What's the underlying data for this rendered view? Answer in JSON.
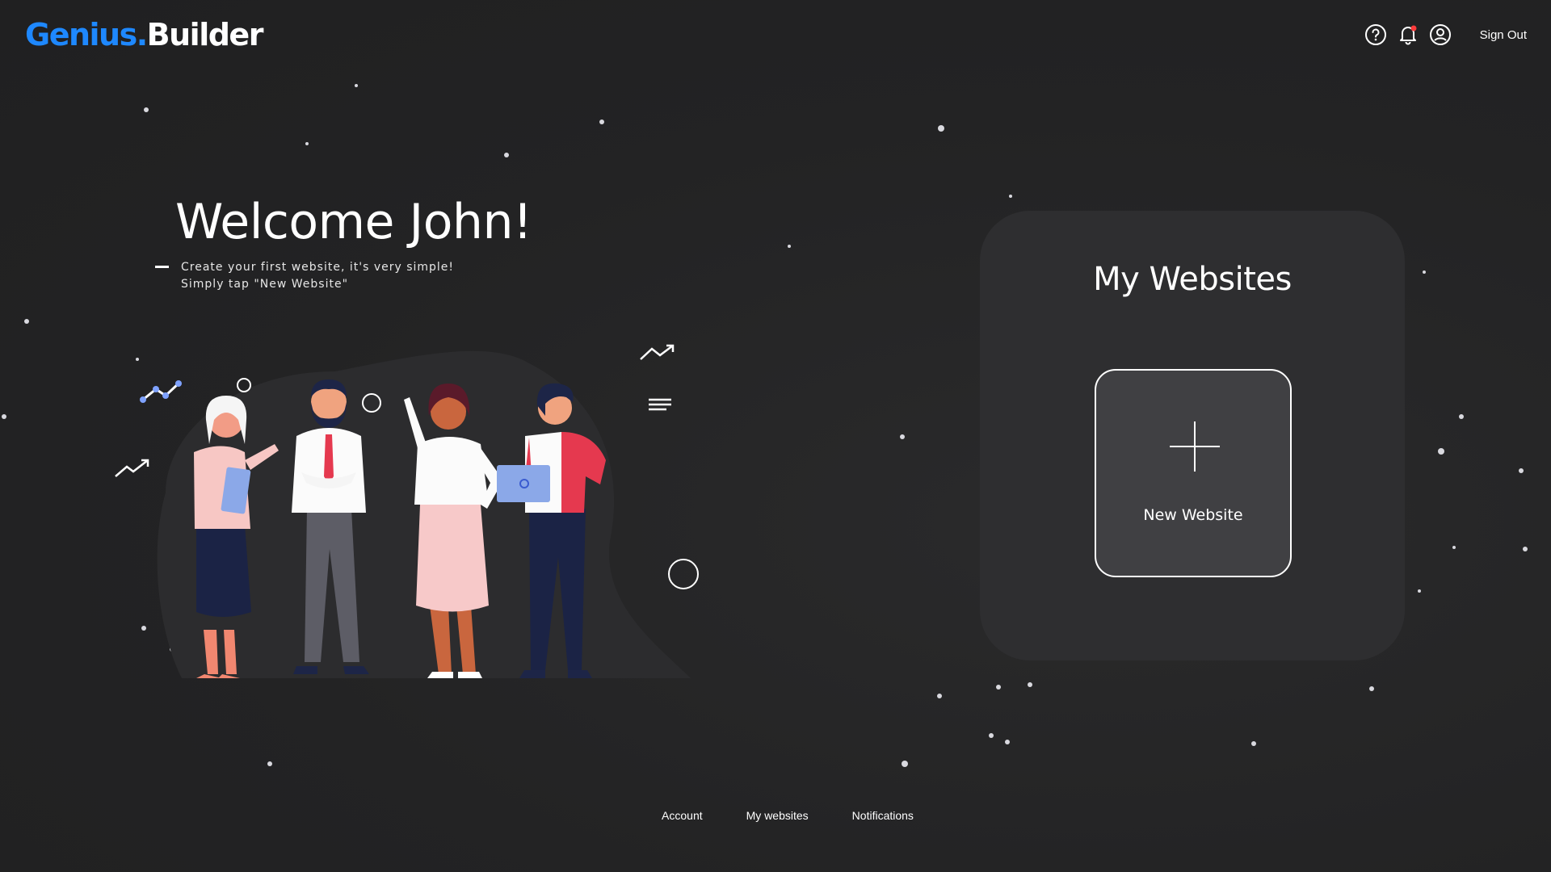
{
  "brand": {
    "part1": "Genius.",
    "part2": "Builder"
  },
  "topnav": {
    "icons": [
      "help-icon",
      "bell-icon",
      "user-icon"
    ],
    "notification_dot_color": "#ff3b3b",
    "sign_out_label": "Sign Out"
  },
  "welcome": {
    "title": "Welcome John!",
    "line1": "Create your first website, it's very simple!",
    "line2": "Simply tap \"New Website\""
  },
  "panel": {
    "title": "My Websites",
    "new_website_label": "New Website"
  },
  "footer": {
    "links": [
      "Account",
      "My websites",
      "Notifications"
    ]
  },
  "colors": {
    "brand_accent": "#1e88ff",
    "background": "#232324",
    "panel": "#2e2e30",
    "card": "#404043"
  }
}
